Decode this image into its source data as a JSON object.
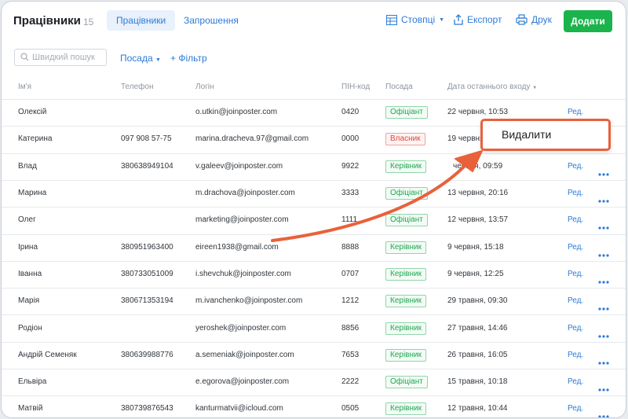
{
  "header": {
    "title": "Працівники",
    "count": "15",
    "tabs": [
      "Працівники",
      "Запрошення"
    ],
    "columns_label": "Стовпці",
    "export_label": "Експорт",
    "print_label": "Друк",
    "add_label": "Додати"
  },
  "filters": {
    "search_placeholder": "Швидкий пошук",
    "position_label": "Посада",
    "add_filter_label": "+ Фільтр"
  },
  "table": {
    "columns": [
      "Ім'я",
      "Телефон",
      "Логін",
      "ПІН-код",
      "Посада",
      "Дата останнього входу"
    ],
    "edit_label": "Ред.",
    "rows": [
      {
        "name": "Олексій",
        "phone": "",
        "login": "o.utkin@joinposter.com",
        "pin": "0420",
        "role": "Офіціант",
        "role_color": "green",
        "last": "22 червня, 10:53"
      },
      {
        "name": "Катерина",
        "phone": "097 908 57-75",
        "login": "marina.dracheva.97@gmail.com",
        "pin": "0000",
        "role": "Власник",
        "role_color": "red",
        "last": "19 червня"
      },
      {
        "name": "Влад",
        "phone": "380638949104",
        "login": "v.galeev@joinposter.com",
        "pin": "9922",
        "role": "Керівник",
        "role_color": "green",
        "last": "червня, 09:59"
      },
      {
        "name": "Марина",
        "phone": "",
        "login": "m.drachova@joinposter.com",
        "pin": "3333",
        "role": "Офіціант",
        "role_color": "green",
        "last": "13 червня, 20:16"
      },
      {
        "name": "Олег",
        "phone": "",
        "login": "marketing@joinposter.com",
        "pin": "1111",
        "role": "Офіціант",
        "role_color": "green",
        "last": "12 червня, 13:57"
      },
      {
        "name": "Ірина",
        "phone": "380951963400",
        "login": "eireen1938@gmail.com",
        "pin": "8888",
        "role": "Керівник",
        "role_color": "green",
        "last": "9 червня, 15:18"
      },
      {
        "name": "Іванна",
        "phone": "380733051009",
        "login": "i.shevchuk@joinposter.com",
        "pin": "0707",
        "role": "Керівник",
        "role_color": "green",
        "last": "9 червня, 12:25"
      },
      {
        "name": "Марія",
        "phone": "380671353194",
        "login": "m.ivanchenko@joinposter.com",
        "pin": "1212",
        "role": "Керівник",
        "role_color": "green",
        "last": "29 травня, 09:30"
      },
      {
        "name": "Родіон",
        "phone": "",
        "login": "yeroshek@joinposter.com",
        "pin": "8856",
        "role": "Керівник",
        "role_color": "green",
        "last": "27 травня, 14:46"
      },
      {
        "name": "Андрій Семеняк",
        "phone": "380639988776",
        "login": "a.semeniak@joinposter.com",
        "pin": "7653",
        "role": "Керівник",
        "role_color": "green",
        "last": "26 травня, 16:05"
      },
      {
        "name": "Ельвіра",
        "phone": "",
        "login": "e.egorova@joinposter.com",
        "pin": "2222",
        "role": "Офіціант",
        "role_color": "green",
        "last": "15 травня, 10:18"
      },
      {
        "name": "Матвій",
        "phone": "380739876543",
        "login": "kanturmatvii@icloud.com",
        "pin": "0505",
        "role": "Керівник",
        "role_color": "green",
        "last": "12 травня, 10:44"
      }
    ]
  },
  "popup": {
    "delete_label": "Видалити"
  },
  "colors": {
    "accent": "#2e7bd6",
    "add_button": "#1bb34b",
    "arrow": "#e8613b"
  }
}
